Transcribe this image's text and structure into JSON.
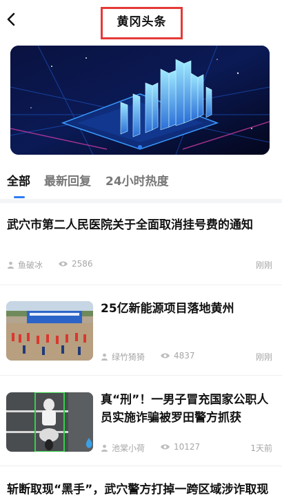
{
  "header": {
    "back_icon": "chevron-left-icon",
    "title": "黄冈头条"
  },
  "banner": {
    "slide_count": 1,
    "active_index": 0
  },
  "tabs": [
    {
      "label": "全部",
      "active": true
    },
    {
      "label": "最新回复",
      "active": false
    },
    {
      "label": "24小时热度",
      "active": false
    }
  ],
  "news": [
    {
      "title": "武穴市第二人民医院关于全面取消挂号费的通知",
      "author": "鱼破冰",
      "views": "2586",
      "time": "刚刚",
      "has_image": false
    },
    {
      "title": "25亿新能源项目落地黄州",
      "author": "绿竹猗猗",
      "views": "4837",
      "time": "刚刚",
      "has_image": true
    },
    {
      "title_line1": "真“刑”！一男子冒充国家公职人",
      "title_line2": "员实施诈骗被罗田警方抓获",
      "author": "池棠小荷",
      "views": "10127",
      "time": "1天前",
      "has_image": true
    },
    {
      "title": "斩断取现“黑手”，武穴警方打掉一跨区域涉诈取现"
    }
  ],
  "colors": {
    "accent": "#2f7cf6",
    "highlight_box": "#e53935",
    "meta_text": "#a6a6a6"
  }
}
